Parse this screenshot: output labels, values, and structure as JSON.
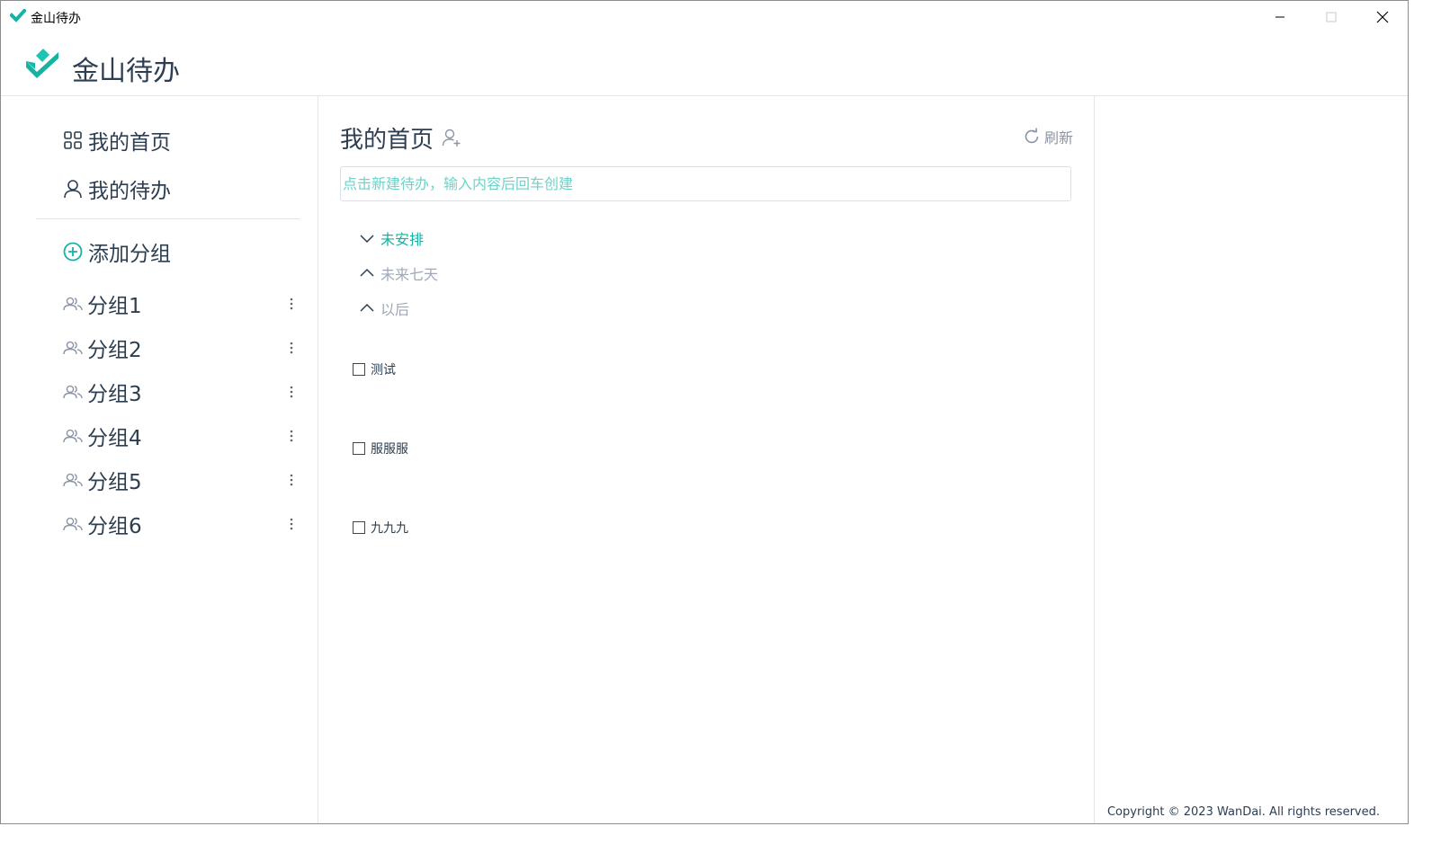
{
  "window": {
    "title": "金山待办",
    "controls": {
      "minimize": "minimize-icon",
      "maximize": "maximize-icon",
      "close": "close-icon"
    }
  },
  "header": {
    "brand": "金山待办"
  },
  "colors": {
    "accent": "#16b3a3",
    "text": "#2c3e50",
    "muted": "#a0a8b8",
    "placeholder": "#70d2c8"
  },
  "sidebar": {
    "nav": [
      {
        "label": "我的首页",
        "icon": "grid-icon"
      },
      {
        "label": "我的待办",
        "icon": "user-icon"
      }
    ],
    "add_group": {
      "label": "添加分组",
      "icon": "plus-circle-icon"
    },
    "groups": [
      {
        "label": "分组1"
      },
      {
        "label": "分组2"
      },
      {
        "label": "分组3"
      },
      {
        "label": "分组4"
      },
      {
        "label": "分组5"
      },
      {
        "label": "分组6"
      }
    ]
  },
  "main": {
    "title": "我的首页",
    "refresh_label": "刷新",
    "new_todo_placeholder": "点击新建待办，输入内容后回车创建",
    "sections": [
      {
        "label": "未安排",
        "expanded": true
      },
      {
        "label": "未来七天",
        "expanded": false
      },
      {
        "label": "以后",
        "expanded": false
      }
    ],
    "todos": [
      {
        "text": "测试",
        "done": false
      },
      {
        "text": "服服服",
        "done": false
      },
      {
        "text": "九九九",
        "done": false
      }
    ]
  },
  "footer": {
    "copyright": "Copyright © 2023 WanDai. All rights reserved."
  }
}
